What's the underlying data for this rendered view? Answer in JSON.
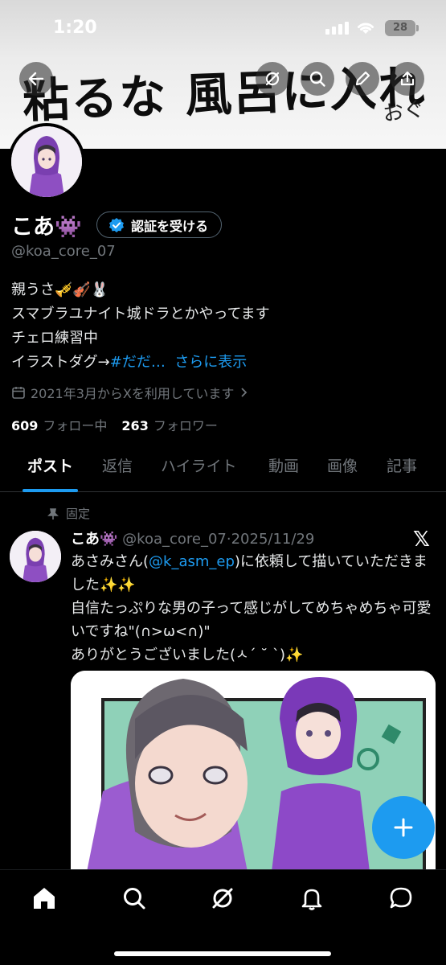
{
  "status_bar": {
    "time": "1:20",
    "battery": "28"
  },
  "banner": {
    "main_text": "粘るな 風呂に入れ",
    "signature": "おぐ"
  },
  "top_actions": [
    "back-icon",
    "grok-icon",
    "search-icon",
    "edit-icon",
    "share-icon"
  ],
  "profile": {
    "name": "こあ👾",
    "verify_label": "認証を受ける",
    "handle": "@koa_core_07",
    "bio_line1": "親うさ🎺🎻🐰",
    "bio_line2": "スマブラユナイト城ドラとかやってます",
    "bio_line3": "チェロ練習中",
    "bio_line4_prefix": "イラストダグ→",
    "bio_line4_link": "#だだ…",
    "bio_more": "さらに表示",
    "joined": "2021年3月からXを利用しています",
    "following_count": "609",
    "following_label": "フォロー中",
    "followers_count": "263",
    "followers_label": "フォロワー"
  },
  "tabs": [
    {
      "label": "ポスト",
      "active": true
    },
    {
      "label": "返信"
    },
    {
      "label": "ハイライト"
    },
    {
      "label": "動画"
    },
    {
      "label": "画像"
    },
    {
      "label": "記事"
    }
  ],
  "pinned_post": {
    "pinned_label": "固定",
    "name": "こあ👾",
    "handle_date": "@koa_core_07·2025/11/29",
    "text_a": "あさみさん(",
    "mention": "@k_asm_ep",
    "text_b": ")に依頼して描いていただきました✨✨",
    "text_c": "自信たっぷりな男の子って感じがしてめちゃめちゃ可愛いですね\"(∩>ω<∩)\"",
    "text_d": "ありがとうございました(ㅅ´ ˘ `)✨"
  },
  "colors": {
    "accent": "#1d9bf0",
    "background": "#000000",
    "muted": "#71767b"
  },
  "bottom_nav": [
    "home-icon",
    "search-icon",
    "grok-icon",
    "notifications-icon",
    "messages-icon"
  ]
}
